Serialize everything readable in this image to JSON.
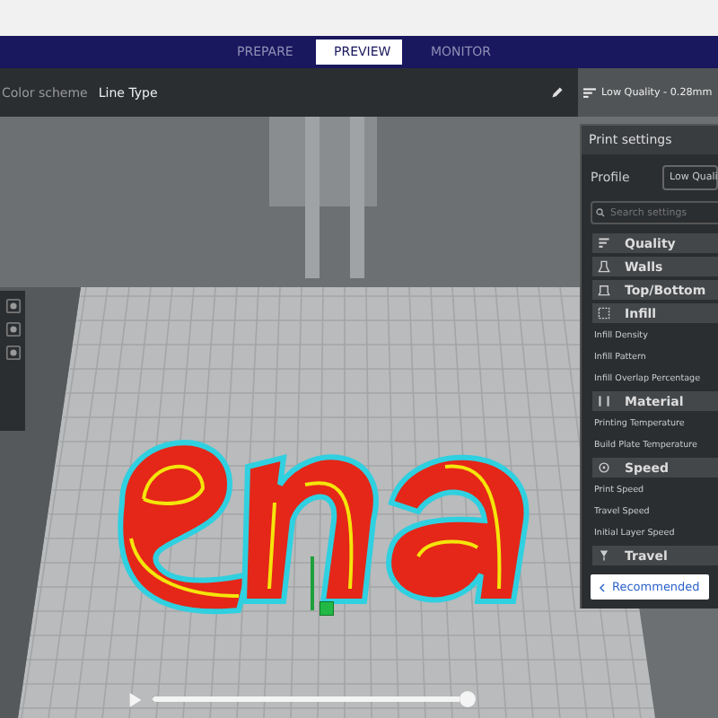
{
  "tabs": [
    {
      "label": "PREPARE",
      "selected": false
    },
    {
      "label": "PREVIEW",
      "selected": true
    },
    {
      "label": "MONITOR",
      "selected": false
    }
  ],
  "toolbar": {
    "color_scheme_label": "Color scheme",
    "color_scheme_value": "Line Type",
    "profile_summary": "Low Quality - 0.28mm"
  },
  "print_settings": {
    "title": "Print settings",
    "profile_label": "Profile",
    "profile_value": "Low Quali",
    "search": {
      "placeholder": "Search settings"
    },
    "items": [
      {
        "kind": "category",
        "label": "Quality"
      },
      {
        "kind": "category",
        "label": "Walls"
      },
      {
        "kind": "category",
        "label": "Top/Bottom"
      },
      {
        "kind": "category",
        "label": "Infill"
      },
      {
        "kind": "setting",
        "label": "Infill Density"
      },
      {
        "kind": "setting",
        "label": "Infill Pattern"
      },
      {
        "kind": "setting",
        "label": "Infill Overlap Percentage"
      },
      {
        "kind": "category",
        "label": "Material"
      },
      {
        "kind": "setting",
        "label": "Printing Temperature"
      },
      {
        "kind": "setting",
        "label": "Build Plate Temperature"
      },
      {
        "kind": "category",
        "label": "Speed"
      },
      {
        "kind": "setting",
        "label": "Print Speed"
      },
      {
        "kind": "setting",
        "label": "Travel Speed"
      },
      {
        "kind": "setting",
        "label": "Initial Layer Speed"
      },
      {
        "kind": "category",
        "label": "Travel"
      }
    ],
    "recommended_button": "Recommended"
  },
  "timeline": {
    "level": 1.0
  }
}
